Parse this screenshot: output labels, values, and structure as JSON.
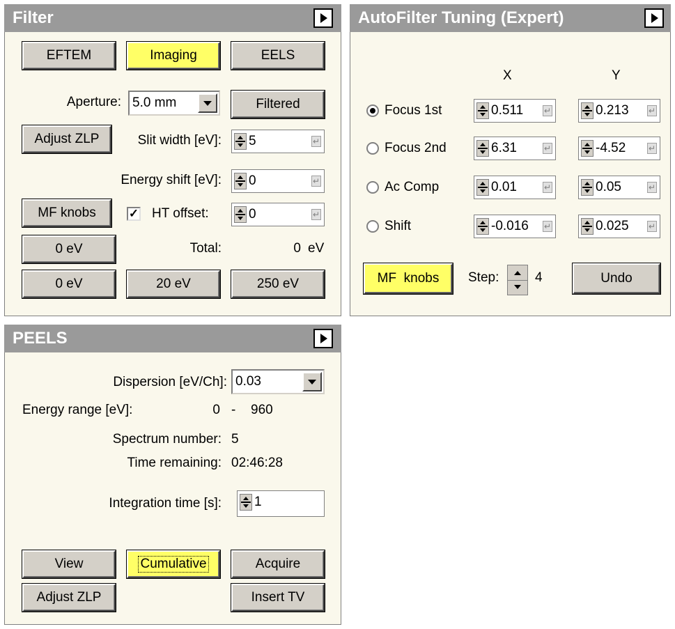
{
  "filter": {
    "title": "Filter",
    "eftem": "EFTEM",
    "imaging": "Imaging",
    "eels": "EELS",
    "aperture_label": "Aperture:",
    "aperture_value": "5.0 mm",
    "filtered": "Filtered",
    "adjust_zlp": "Adjust ZLP",
    "slit_label": "Slit width [eV]:",
    "slit_value": "5",
    "energy_shift_label": "Energy shift [eV]:",
    "energy_shift_value": "0",
    "mf_knobs": "MF knobs",
    "ht_offset_label": "HT offset:",
    "ht_offset_checked": true,
    "ht_offset_value": "0",
    "zero_ev_1": "0 eV",
    "total_label": "Total:",
    "total_value": "0",
    "total_unit": "eV",
    "zero_ev_2": "0 eV",
    "twenty_ev": "20 eV",
    "two_fifty_ev": "250 eV"
  },
  "autofilter": {
    "title": "AutoFilter Tuning (Expert)",
    "col_x": "X",
    "col_y": "Y",
    "rows": [
      {
        "label": "Focus 1st",
        "x": "0.511",
        "y": "0.213",
        "selected": true
      },
      {
        "label": "Focus 2nd",
        "x": "6.31",
        "y": "-4.52",
        "selected": false
      },
      {
        "label": "Ac Comp",
        "x": "0.01",
        "y": "0.05",
        "selected": false
      },
      {
        "label": "Shift",
        "x": "-0.016",
        "y": "0.025",
        "selected": false
      }
    ],
    "mf_knobs": "MF  knobs",
    "step_label": "Step:",
    "step_value": "4",
    "undo": "Undo"
  },
  "peels": {
    "title": "PEELS",
    "dispersion_label": "Dispersion [eV/Ch]:",
    "dispersion_value": "0.03",
    "energy_range_label": "Energy range [eV]:",
    "energy_range_from": "0",
    "energy_range_sep": "-",
    "energy_range_to": "960",
    "spectrum_label": "Spectrum number:",
    "spectrum_value": "5",
    "time_label": "Time remaining:",
    "time_value": "02:46:28",
    "integration_label": "Integration time [s]:",
    "integration_value": "1",
    "view": "View",
    "cumulative": "Cumulative",
    "acquire": "Acquire",
    "adjust_zlp": "Adjust ZLP",
    "insert_tv": "Insert TV"
  }
}
